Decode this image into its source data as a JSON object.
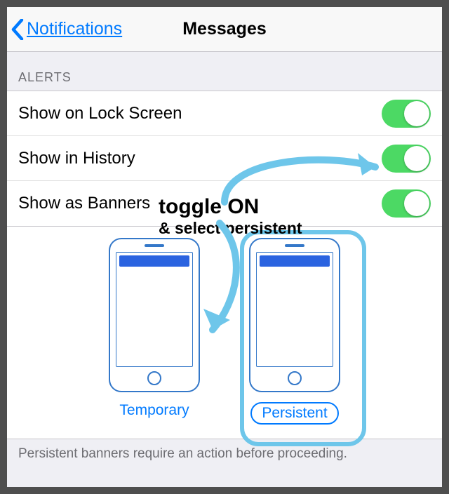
{
  "nav": {
    "back_label": "Notifications",
    "title": "Messages"
  },
  "section": {
    "alerts_header": "ALERTS"
  },
  "rows": {
    "lock_screen": "Show on Lock Screen",
    "history": "Show in History",
    "banners": "Show as Banners"
  },
  "banner_styles": {
    "temporary": "Temporary",
    "persistent": "Persistent"
  },
  "footer": "Persistent banners require an action before proceeding.",
  "annotation": {
    "line1": "toggle ON",
    "line2": "& select persistent"
  },
  "colors": {
    "accent": "#007aff",
    "toggle_on": "#4cd964",
    "annotation_arrow": "#6ec6ea"
  }
}
